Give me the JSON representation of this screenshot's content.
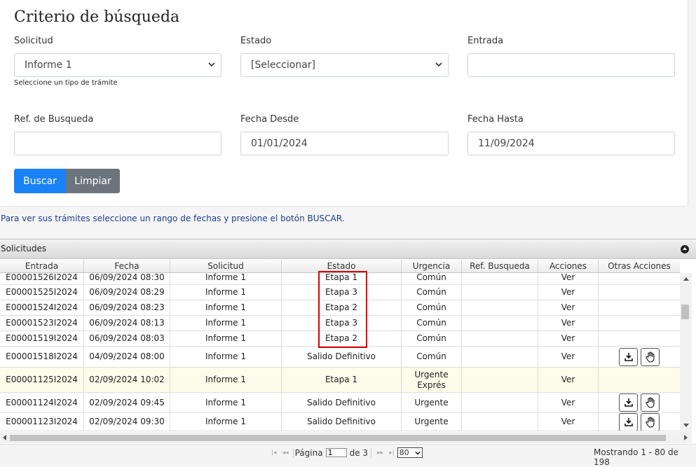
{
  "criteria": {
    "title": "Criterio de búsqueda",
    "solicitud": {
      "label": "Solicitud",
      "value": "Informe 1",
      "hint": "Seleccione un tipo de trámite"
    },
    "estado": {
      "label": "Estado",
      "value": "[Seleccionar]"
    },
    "entrada": {
      "label": "Entrada",
      "value": ""
    },
    "ref": {
      "label": "Ref. de Busqueda",
      "value": ""
    },
    "fecha_desde": {
      "label": "Fecha Desde",
      "value": "01/01/2024"
    },
    "fecha_hasta": {
      "label": "Fecha Hasta",
      "value": "11/09/2024"
    },
    "buttons": {
      "search": "Buscar",
      "clear": "Limpiar"
    }
  },
  "info_text": "Para ver sus trámites seleccione un rango de fechas y presione el botón BUSCAR.",
  "grid": {
    "title": "Solicitudes",
    "columns": [
      "Entrada",
      "Fecha",
      "Solicitud",
      "Estado",
      "Urgencia",
      "Ref. Busqueda",
      "Acciones",
      "Otras Acciones"
    ],
    "rows": [
      {
        "entrada": "E00001526I2024",
        "fecha": "06/09/2024 08:30",
        "solicitud": "Informe 1",
        "estado": "Etapa 1",
        "urgencia": "Común",
        "ref": "",
        "accion": "Ver"
      },
      {
        "entrada": "E00001525I2024",
        "fecha": "06/09/2024 08:29",
        "solicitud": "Informe 1",
        "estado": "Etapa 3",
        "urgencia": "Común",
        "ref": "",
        "accion": "Ver"
      },
      {
        "entrada": "E00001524I2024",
        "fecha": "06/09/2024 08:23",
        "solicitud": "Informe 1",
        "estado": "Etapa 2",
        "urgencia": "Común",
        "ref": "",
        "accion": "Ver"
      },
      {
        "entrada": "E00001523I2024",
        "fecha": "06/09/2024 08:13",
        "solicitud": "Informe 1",
        "estado": "Etapa 3",
        "urgencia": "Común",
        "ref": "",
        "accion": "Ver"
      },
      {
        "entrada": "E00001519I2024",
        "fecha": "06/09/2024 08:03",
        "solicitud": "Informe 1",
        "estado": "Etapa 2",
        "urgencia": "Común",
        "ref": "",
        "accion": "Ver"
      },
      {
        "entrada": "E00001518I2024",
        "fecha": "04/09/2024 08:00",
        "solicitud": "Informe 1",
        "estado": "Salido Definitivo",
        "urgencia": "Común",
        "ref": "",
        "accion": "Ver"
      },
      {
        "entrada": "E00001125I2024",
        "fecha": "02/09/2024 10:02",
        "solicitud": "Informe 1",
        "estado": "Etapa 1",
        "urgencia": "Urgente Exprés",
        "ref": "",
        "accion": "Ver"
      },
      {
        "entrada": "E00001124I2024",
        "fecha": "02/09/2024 09:45",
        "solicitud": "Informe 1",
        "estado": "Salido Definitivo",
        "urgencia": "Urgente",
        "ref": "",
        "accion": "Ver"
      },
      {
        "entrada": "E00001123I2024",
        "fecha": "02/09/2024 09:30",
        "solicitud": "Informe 1",
        "estado": "Salido Definitivo",
        "urgencia": "Urgente",
        "ref": "",
        "accion": "Ver"
      }
    ]
  },
  "pager": {
    "page_label": "Página",
    "page_value": "1",
    "of_label": "de 3",
    "page_size": "80",
    "summary": "Mostrando 1 - 80 de 198"
  },
  "colors": {
    "primary": "#1a82f7",
    "secondary": "#6c757d",
    "highlight_box": "#dd0000",
    "info_text": "#1d3d8f"
  },
  "icons": [
    "chevron-down-icon",
    "download-icon",
    "hand-icon",
    "collapse-icon",
    "first-page-icon",
    "prev-page-icon",
    "next-page-icon",
    "last-page-icon"
  ]
}
